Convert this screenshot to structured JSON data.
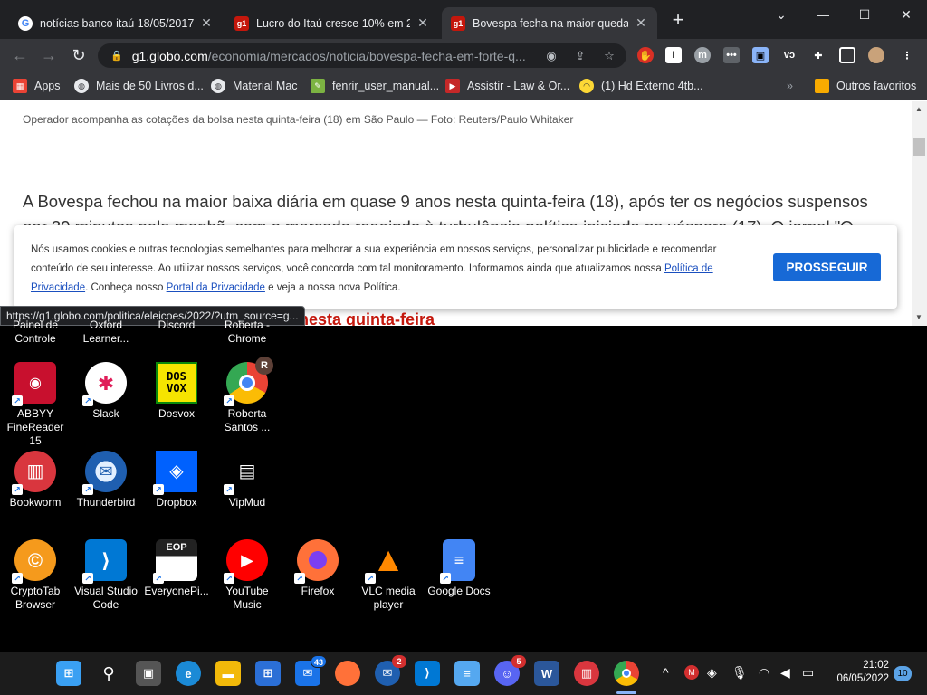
{
  "browser": {
    "tabs": [
      {
        "title": "notícias banco itaú 18/05/2017 -",
        "favicon": "google-icon",
        "active": false
      },
      {
        "title": "Lucro do Itaú cresce 10% em 201",
        "favicon": "g1-icon",
        "active": false
      },
      {
        "title": "Bovespa fecha na maior queda e",
        "favicon": "g1-icon",
        "active": true
      }
    ],
    "new_tab": "+",
    "window_controls": {
      "minimize": "—",
      "maximize": "☐",
      "close": "✕"
    },
    "address": {
      "host": "g1.globo.com",
      "path": "/economia/mercados/noticia/bovespa-fecha-em-forte-q..."
    },
    "favicon_g1": "g1",
    "bookmarks": [
      {
        "label": "Apps",
        "icon": "apps-grid-icon"
      },
      {
        "label": "Mais de 50 Livros d...",
        "icon": "globe-icon"
      },
      {
        "label": "Material Mac",
        "icon": "globe-icon"
      },
      {
        "label": "fenrir_user_manual...",
        "icon": "document-icon"
      },
      {
        "label": "Assistir - Law & Or...",
        "icon": "play-icon"
      },
      {
        "label": "(1) Hd Externo 4tb...",
        "icon": "shop-icon"
      }
    ],
    "bookmarks_more": "»",
    "other_favorites": "Outros favoritos",
    "status_url": "https://g1.globo.com/politica/eleicoes/2022/?utm_source=g..."
  },
  "page": {
    "caption": "Operador acompanha as cotações da bolsa nesta quinta-feira (18) em São Paulo — Foto: Reuters/Paulo Whitaker",
    "paragraph": "A Bovespa fechou na maior baixa diária em quase 9 anos nesta quinta-feira (18), após ter os negócios suspensos por 30 minutos pela manhã, com o mercado reagindo à turbulência política iniciada na véspera (17). O jornal \"O Globo\"",
    "headline_fragment": "nesta quinta-feira",
    "cookie": {
      "text_1": "Nós usamos cookies e outras tecnologias semelhantes para melhorar a sua experiência em nossos serviços, personalizar publicidade e recomendar conteúdo de seu interesse. Ao utilizar nossos serviços, você concorda com tal monitoramento. Informamos ainda que atualizamos nossa ",
      "link_1": "Política de Privacidade",
      "text_2": ". Conheça nosso ",
      "link_2": "Portal da Privacidade",
      "text_3": " e veja a nossa nova Política.",
      "button": "PROSSEGUIR"
    }
  },
  "desktop": {
    "partial_row": [
      {
        "label": "Painel de Controle"
      },
      {
        "label": "Oxford Learner..."
      },
      {
        "label": "Discord"
      },
      {
        "label": "Roberta - Chrome"
      }
    ],
    "icons": [
      {
        "label": "ABBYY FineReader 15",
        "icon": "abbyy-icon",
        "color": "#c8102e"
      },
      {
        "label": "Slack",
        "icon": "slack-icon",
        "color": "#ffffff"
      },
      {
        "label": "Dosvox",
        "icon": "dosvox-icon",
        "color": "#f5e400",
        "text": "DOS VOX"
      },
      {
        "label": "Roberta Santos ...",
        "icon": "chrome-profile-icon",
        "color": "#4285f4",
        "badge": "R"
      },
      {
        "label": "Bookworm",
        "icon": "bookworm-icon",
        "color": "#d9363e"
      },
      {
        "label": "Thunderbird",
        "icon": "thunderbird-icon",
        "color": "#1f5fb0"
      },
      {
        "label": "Dropbox",
        "icon": "dropbox-icon",
        "color": "#0061fe"
      },
      {
        "label": "VipMud",
        "icon": "vipmud-icon",
        "color": "#000000"
      },
      {
        "label": "CryptoTab Browser",
        "icon": "cryptotab-icon",
        "color": "#f59a1c"
      },
      {
        "label": "Visual Studio Code",
        "icon": "vscode-icon",
        "color": "#0078d4"
      },
      {
        "label": "EveryonePi...",
        "icon": "everyonepiano-icon",
        "color": "#222222",
        "text": "EOP"
      },
      {
        "label": "YouTube Music",
        "icon": "youtube-music-icon",
        "color": "#ff0000"
      },
      {
        "label": "Firefox",
        "icon": "firefox-icon",
        "color": "#ff7139"
      },
      {
        "label": "VLC media player",
        "icon": "vlc-icon",
        "color": "#ff8800"
      },
      {
        "label": "Google Docs",
        "icon": "google-docs-icon",
        "color": "#4285f4"
      }
    ]
  },
  "taskbar": {
    "apps": [
      {
        "name": "start-button",
        "icon": "windows-icon",
        "color": "#3aa0f3"
      },
      {
        "name": "search-button",
        "icon": "search-icon",
        "color": "#1c1c1c"
      },
      {
        "name": "task-view-button",
        "icon": "task-view-icon",
        "color": "#555555"
      },
      {
        "name": "edge-button",
        "icon": "edge-icon",
        "color": "#1b8ad6"
      },
      {
        "name": "explorer-button",
        "icon": "folder-icon",
        "color": "#f2b90a"
      },
      {
        "name": "store-button",
        "icon": "store-icon",
        "color": "#2b6fd6"
      },
      {
        "name": "mail-button",
        "icon": "mail-icon",
        "color": "#1a73e8",
        "badge": "43"
      },
      {
        "name": "firefox-button",
        "icon": "firefox-icon",
        "color": "#ff7139"
      },
      {
        "name": "thunderbird-button",
        "icon": "thunderbird-icon",
        "color": "#1f5fb0",
        "badge": "2"
      },
      {
        "name": "vscode-button",
        "icon": "vscode-icon",
        "color": "#0078d4"
      },
      {
        "name": "notepad-button",
        "icon": "notepad-icon",
        "color": "#55a8f0"
      },
      {
        "name": "discord-button",
        "icon": "discord-icon",
        "color": "#5865f2",
        "badge": "5"
      },
      {
        "name": "word-button",
        "icon": "word-icon",
        "color": "#2b579a"
      },
      {
        "name": "bookworm-button",
        "icon": "bookworm-icon",
        "color": "#d9363e"
      },
      {
        "name": "chrome-button",
        "icon": "chrome-icon",
        "color": "#4285f4"
      }
    ],
    "tray": {
      "chevron": "^",
      "time": "21:02",
      "date": "06/05/2022",
      "notifications": "10"
    }
  }
}
